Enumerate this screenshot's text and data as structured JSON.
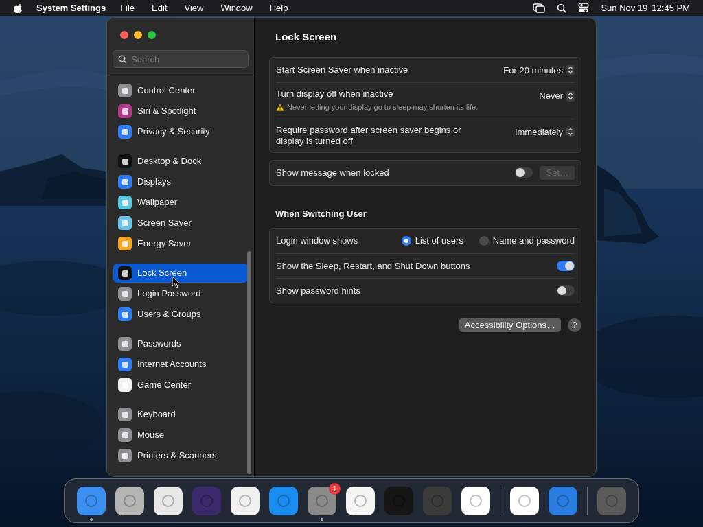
{
  "menubar": {
    "app": "System Settings",
    "menus": [
      "File",
      "Edit",
      "View",
      "Window",
      "Help"
    ],
    "date": "Sun Nov 19",
    "time": "12:45 PM"
  },
  "sidebar": {
    "search": {
      "placeholder": "Search"
    },
    "groups": [
      [
        {
          "label": "Control Center",
          "color": "#8e8e93",
          "selected": false
        },
        {
          "label": "Siri & Spotlight",
          "color": "#b23a8a",
          "selected": false
        },
        {
          "label": "Privacy & Security",
          "color": "#2f7cf6",
          "selected": false
        }
      ],
      [
        {
          "label": "Desktop & Dock",
          "color": "#111111",
          "selected": false
        },
        {
          "label": "Displays",
          "color": "#2f7cf6",
          "selected": false
        },
        {
          "label": "Wallpaper",
          "color": "#5ac8e0",
          "selected": false
        },
        {
          "label": "Screen Saver",
          "color": "#6cc4e8",
          "selected": false
        },
        {
          "label": "Energy Saver",
          "color": "#f5a623",
          "selected": false
        }
      ],
      [
        {
          "label": "Lock Screen",
          "color": "#111111",
          "selected": true
        },
        {
          "label": "Login Password",
          "color": "#8e8e93",
          "selected": false
        },
        {
          "label": "Users & Groups",
          "color": "#2f7cf6",
          "selected": false
        }
      ],
      [
        {
          "label": "Passwords",
          "color": "#8e8e93",
          "selected": false
        },
        {
          "label": "Internet Accounts",
          "color": "#2f7cf6",
          "selected": false
        },
        {
          "label": "Game Center",
          "color": "#f2f2f2",
          "selected": false
        }
      ],
      [
        {
          "label": "Keyboard",
          "color": "#8e8e93",
          "selected": false
        },
        {
          "label": "Mouse",
          "color": "#8e8e93",
          "selected": false
        },
        {
          "label": "Printers & Scanners",
          "color": "#8e8e93",
          "selected": false
        }
      ]
    ]
  },
  "content": {
    "title": "Lock Screen",
    "sections": [
      {
        "rows": [
          {
            "kind": "popup",
            "label": "Start Screen Saver when inactive",
            "value": "For 20 minutes"
          },
          {
            "kind": "popup",
            "label": "Turn display off when inactive",
            "value": "Never",
            "warning": "Never letting your display go to sleep may shorten its life."
          },
          {
            "kind": "popup",
            "label": "Require password after screen saver begins or display is turned off",
            "value": "Immediately"
          }
        ]
      },
      {
        "rows": [
          {
            "kind": "toggle",
            "label": "Show message when locked",
            "on": false,
            "button": {
              "label": "Set…",
              "disabled": true
            }
          }
        ]
      },
      {
        "heading": "When Switching User",
        "rows": [
          {
            "kind": "radio",
            "label": "Login window shows",
            "options": [
              {
                "label": "List of users",
                "selected": true
              },
              {
                "label": "Name and password",
                "selected": false
              }
            ]
          },
          {
            "kind": "toggle",
            "label": "Show the Sleep, Restart, and Shut Down buttons",
            "on": true
          },
          {
            "kind": "toggle",
            "label": "Show password hints",
            "on": false
          }
        ]
      }
    ],
    "footer": {
      "button": "Accessibility Options…",
      "help": "?"
    }
  },
  "dock": [
    {
      "color": "#3b8ff0",
      "running": true
    },
    {
      "color": "#b5b5b5",
      "running": false
    },
    {
      "color": "#e8e8e8",
      "running": false
    },
    {
      "color": "#3b2a6b",
      "running": false
    },
    {
      "color": "#f0f0f0",
      "running": false
    },
    {
      "color": "#1a8cf0",
      "running": false
    },
    {
      "color": "#8a8a8a",
      "running": true,
      "badge": "1"
    },
    {
      "color": "#f5f5f5",
      "running": false
    },
    {
      "color": "#161616",
      "running": false
    },
    {
      "color": "#3a3a3a",
      "running": false
    },
    {
      "color": "#ffffff",
      "running": false,
      "separator_after": true
    },
    {
      "color": "#ffffff",
      "running": false
    },
    {
      "color": "#2a7de1",
      "running": false,
      "separator_after": true
    },
    {
      "color": "#5a5a5a",
      "running": false
    }
  ]
}
